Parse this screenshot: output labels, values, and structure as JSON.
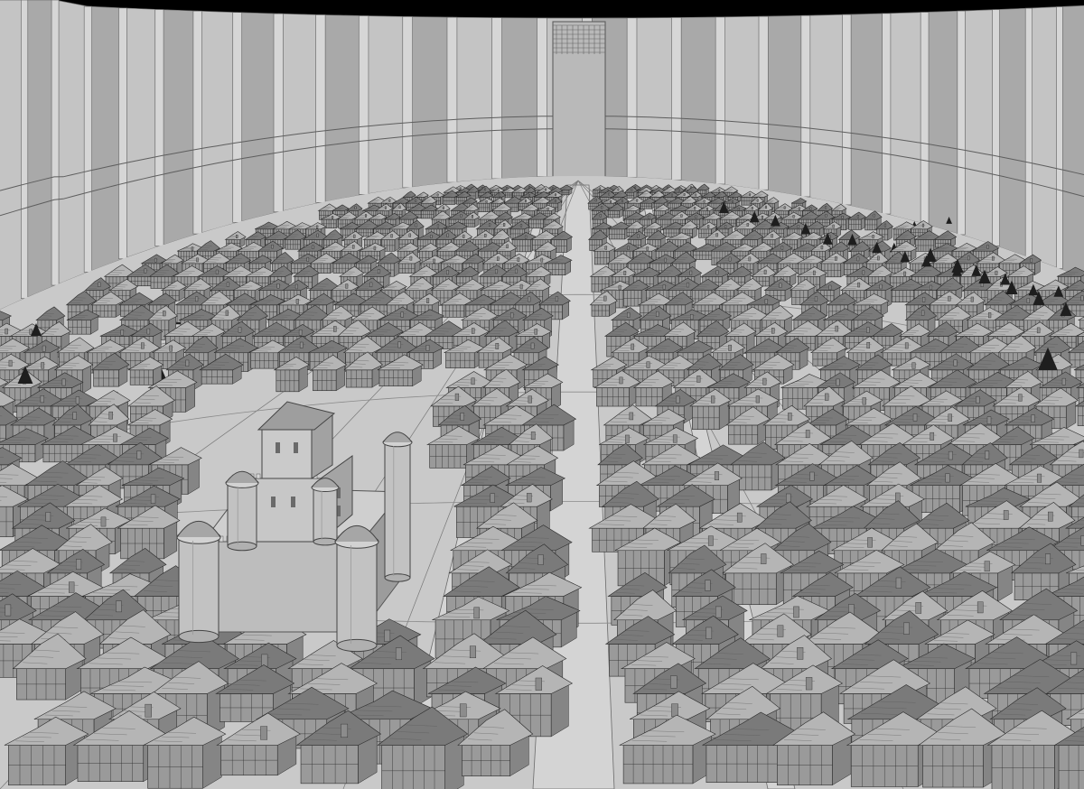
{
  "scene": {
    "colors": {
      "sky": "#000000",
      "wall_face": "#a9a9a9",
      "wall_face_light": "#c4c4c4",
      "wall_rib": "#d6d6d6",
      "wall_shadow": "#7c7c7c",
      "ground": "#c9c9c9",
      "street": "#d4d4d4",
      "roof_light": "#b5b5b5",
      "roof_dark": "#7a7a7a",
      "building_wall": "#9a9a9a",
      "timber_line": "#2a2a2a",
      "castle": "#bdbdbd",
      "castle_shadow": "#9c9c9c",
      "tree": "#1e1e1e"
    }
  }
}
